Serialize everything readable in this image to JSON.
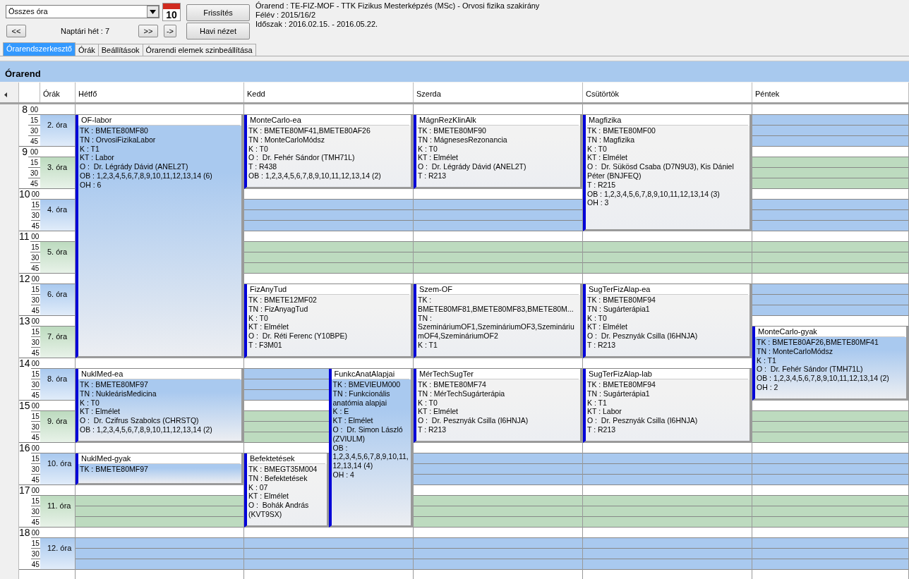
{
  "toolbar": {
    "filter": {
      "value": "Összes óra"
    },
    "calendar_day": "10",
    "refresh_button": "Frissítés",
    "month_view_button": "Havi nézet",
    "prev_button": "<<",
    "week_label": "Naptári hét : 7",
    "next_button": ">>",
    "jump_button": "->",
    "info": [
      "Órarend : TE-FIZ-MOF - TTK Fizikus Mesterképzés (MSc) - Orvosi fizika szakirány",
      "Félév : 2015/16/2",
      "Időszak : 2016.02.15. - 2016.05.22."
    ]
  },
  "tabs": [
    {
      "label": "Órarendszerkesztő",
      "selected": true
    },
    {
      "label": "Órák",
      "selected": false
    },
    {
      "label": "Beállítások",
      "selected": false
    },
    {
      "label": "Órarendi elemek szinbeállítása",
      "selected": false
    }
  ],
  "panel_title": "Órarend",
  "periods_header": "Órák",
  "hours": [
    {
      "hour": "8",
      "minutes": [
        "00",
        "15",
        "30",
        "45"
      ],
      "period": "2. óra",
      "color": "#a9c9ef"
    },
    {
      "hour": "9",
      "minutes": [
        "00",
        "15",
        "30",
        "45"
      ],
      "period": "3. óra",
      "color": "#bddbbf"
    },
    {
      "hour": "10",
      "minutes": [
        "00",
        "15",
        "30",
        "45"
      ],
      "period": "4. óra",
      "color": "#a9c9ef"
    },
    {
      "hour": "11",
      "minutes": [
        "00",
        "15",
        "30",
        "45"
      ],
      "period": "5. óra",
      "color": "#bddbbf"
    },
    {
      "hour": "12",
      "minutes": [
        "00",
        "15",
        "30",
        "45"
      ],
      "period": "6. óra",
      "color": "#a9c9ef"
    },
    {
      "hour": "13",
      "minutes": [
        "00",
        "15",
        "30",
        "45"
      ],
      "period": "7. óra",
      "color": "#bddbbf"
    },
    {
      "hour": "14",
      "minutes": [
        "00",
        "15",
        "30",
        "45"
      ],
      "period": "8. óra",
      "color": "#a9c9ef"
    },
    {
      "hour": "15",
      "minutes": [
        "00",
        "15",
        "30",
        "45"
      ],
      "period": "9. óra",
      "color": "#bddbbf"
    },
    {
      "hour": "16",
      "minutes": [
        "00",
        "15",
        "30",
        "45"
      ],
      "period": "10. óra",
      "color": "#a9c9ef"
    },
    {
      "hour": "17",
      "minutes": [
        "00",
        "15",
        "30",
        "45"
      ],
      "period": "11. óra",
      "color": "#bddbbf"
    },
    {
      "hour": "18",
      "minutes": [
        "00",
        "15",
        "30",
        "45"
      ],
      "period": "12. óra",
      "color": "#a9c9ef"
    }
  ],
  "days": [
    {
      "name": "Hétfő",
      "slots": [
        [
          {
            "kind": "event",
            "title": "OF-labor",
            "color": "#a9c9ef",
            "lines": [
              "TK : BMETE80MF80",
              "TN : OrvosiFizikaLabor",
              "K : T1",
              "KT : Labor",
              "O :  Dr. Légrády Dávid (ANEL2T)",
              "OB : 1,2,3,4,5,6,7,8,9,10,11,12,13,14 (6)",
              "OH : 6"
            ]
          }
        ],
        [
          {
            "kind": "continued"
          }
        ],
        [
          {
            "kind": "continued"
          }
        ],
        [
          {
            "kind": "continued"
          }
        ],
        [
          {
            "kind": "continued"
          }
        ],
        [
          {
            "kind": "continued"
          }
        ],
        [
          {
            "kind": "event",
            "title": "NuklMed-ea",
            "color": "#a9c9ef",
            "lines": [
              "TK : BMETE80MF97",
              "TN : NukleárisMedicina",
              "K : T0",
              "KT : Elmélet",
              "O :  Dr. Czifrus Szabolcs (CHRSTQ)",
              "OB : 1,2,3,4,5,6,7,8,9,10,11,12,13,14 (2)"
            ]
          }
        ],
        [
          {
            "kind": "continued"
          }
        ],
        [
          {
            "kind": "event",
            "title": "NuklMed-gyak",
            "color": "#a9c9ef",
            "lines": [
              "TK : BMETE80MF97"
            ]
          }
        ],
        [
          {
            "kind": "free"
          }
        ],
        [
          {
            "kind": "free"
          }
        ]
      ]
    },
    {
      "name": "Kedd",
      "slots": [
        [
          {
            "kind": "event",
            "title": "MonteCarlo-ea",
            "color": "#f2f2f2",
            "lines": [
              "TK : BMETE80MF41,BMETE80AF26",
              "TN : MonteCarloMódsz",
              "K : T0",
              "O :  Dr. Fehér Sándor (TMH71L)",
              "T : R438",
              "OB : 1,2,3,4,5,6,7,8,9,10,11,12,13,14 (2)"
            ]
          }
        ],
        [
          {
            "kind": "continued"
          }
        ],
        [
          {
            "kind": "free"
          }
        ],
        [
          {
            "kind": "free"
          }
        ],
        [
          {
            "kind": "event",
            "title": "FizAnyTud",
            "color": "#f2f2f2",
            "lines": [
              "TK : BMETE12MF02",
              "TN : FizAnyagTud",
              "K : T0",
              "KT : Elmélet",
              "O :  Dr. Réti Ferenc (Y10BPE)",
              "T : F3M01"
            ]
          }
        ],
        [
          {
            "kind": "continued"
          }
        ],
        [
          {
            "kind": "free"
          },
          {
            "kind": "event",
            "title": "FunkcAnatAlapjai",
            "color": "#a9c9ef",
            "lines": [
              "TK : BMEVIEUM000",
              "TN : Funkcionális anatómia alapjai",
              "K : E",
              "KT : Elmélet",
              "O :  Dr. Simon László (ZVIULM)",
              "OB : 1,2,3,4,5,6,7,8,9,10,11,12,13,14 (4)",
              "OH : 4"
            ]
          }
        ],
        [
          {
            "kind": "free"
          },
          {
            "kind": "continued"
          }
        ],
        [
          {
            "kind": "event",
            "title": "Befektetések",
            "color": "#f2f2f2",
            "lines": [
              "TK : BMEGT35M004",
              "TN : Befektetések",
              "K : 07",
              "KT : Elmélet",
              "O :  Bohák András (KVT9SX)"
            ]
          },
          {
            "kind": "continued"
          }
        ],
        [
          {
            "kind": "continued"
          },
          {
            "kind": "continued"
          }
        ],
        [
          {
            "kind": "free"
          }
        ]
      ]
    },
    {
      "name": "Szerda",
      "slots": [
        [
          {
            "kind": "event",
            "title": "MágnRezKlinAlk",
            "color": "#f2f2f2",
            "lines": [
              "TK : BMETE80MF90",
              "TN : MágnesesRezonancia",
              "K : T0",
              "KT : Elmélet",
              "O :  Dr. Légrády Dávid (ANEL2T)",
              "T : R213"
            ]
          }
        ],
        [
          {
            "kind": "continued"
          }
        ],
        [
          {
            "kind": "free"
          }
        ],
        [
          {
            "kind": "free"
          }
        ],
        [
          {
            "kind": "event",
            "title": "Szem-OF",
            "color": "#f2f2f2",
            "lines": [
              "TK : BMETE80MF81,BMETE80MF83,BMETE80M...",
              "TN : SzemináriumOF1,SzemináriumOF3,SzemináriumOF4,SzemináriumOF2",
              "K : T1"
            ]
          }
        ],
        [
          {
            "kind": "continued"
          }
        ],
        [
          {
            "kind": "event",
            "title": "MérTechSugTer",
            "color": "#f2f2f2",
            "lines": [
              "TK : BMETE80MF74",
              "TN : MérTechSugárterápia",
              "K : T0",
              "KT : Elmélet",
              "O :  Dr. Pesznyák Csilla (I6HNJA)",
              "T : R213"
            ]
          }
        ],
        [
          {
            "kind": "continued"
          }
        ],
        [
          {
            "kind": "free"
          }
        ],
        [
          {
            "kind": "free"
          }
        ],
        [
          {
            "kind": "free"
          }
        ]
      ]
    },
    {
      "name": "Csütörtök",
      "slots": [
        [
          {
            "kind": "event",
            "title": "Magfizika",
            "color": "#f2f2f2",
            "lines": [
              "TK : BMETE80MF00",
              "TN : Magfizika",
              "K : T0",
              "KT : Elmélet",
              "O :  Dr. Sükösd Csaba (D7N9U3), Kis Dániel Péter (BNJFEQ)",
              "T : R215",
              "OB : 1,2,3,4,5,6,7,8,9,10,11,12,13,14 (3)",
              "OH : 3"
            ]
          }
        ],
        [
          {
            "kind": "continued"
          }
        ],
        [
          {
            "kind": "continued"
          }
        ],
        [
          {
            "kind": "free"
          }
        ],
        [
          {
            "kind": "event",
            "title": "SugTerFizAlap-ea",
            "color": "#f2f2f2",
            "lines": [
              "TK : BMETE80MF94",
              "TN : Sugárterápia1",
              "K : T0",
              "KT : Elmélet",
              "O :  Dr. Pesznyák Csilla (I6HNJA)",
              "T : R213"
            ]
          }
        ],
        [
          {
            "kind": "continued"
          }
        ],
        [
          {
            "kind": "event",
            "title": "SugTerFizAlap-lab",
            "color": "#f2f2f2",
            "lines": [
              "TK : BMETE80MF94",
              "TN : Sugárterápia1",
              "K : T1",
              "KT : Labor",
              "O :  Dr. Pesznyák Csilla (I6HNJA)",
              "T : R213"
            ]
          }
        ],
        [
          {
            "kind": "continued"
          }
        ],
        [
          {
            "kind": "free"
          }
        ],
        [
          {
            "kind": "free"
          }
        ],
        [
          {
            "kind": "free"
          }
        ]
      ]
    },
    {
      "name": "Péntek",
      "slots": [
        [
          {
            "kind": "free"
          }
        ],
        [
          {
            "kind": "free"
          }
        ],
        [
          {
            "kind": "free"
          }
        ],
        [
          {
            "kind": "free"
          }
        ],
        [
          {
            "kind": "free"
          }
        ],
        [
          {
            "kind": "event",
            "title": "MonteCarlo-gyak",
            "color": "#a9c9ef",
            "lines": [
              "TK : BMETE80AF26,BMETE80MF41",
              "TN : MonteCarloMódsz",
              "K : T1",
              "O :  Dr. Fehér Sándor (TMH71L)",
              "OB : 1,2,3,4,5,6,7,8,9,10,11,12,13,14 (2)",
              "OH : 2"
            ]
          }
        ],
        [
          {
            "kind": "continued"
          }
        ],
        [
          {
            "kind": "free"
          }
        ],
        [
          {
            "kind": "free"
          }
        ],
        [
          {
            "kind": "free"
          }
        ],
        [
          {
            "kind": "free"
          }
        ]
      ]
    }
  ]
}
